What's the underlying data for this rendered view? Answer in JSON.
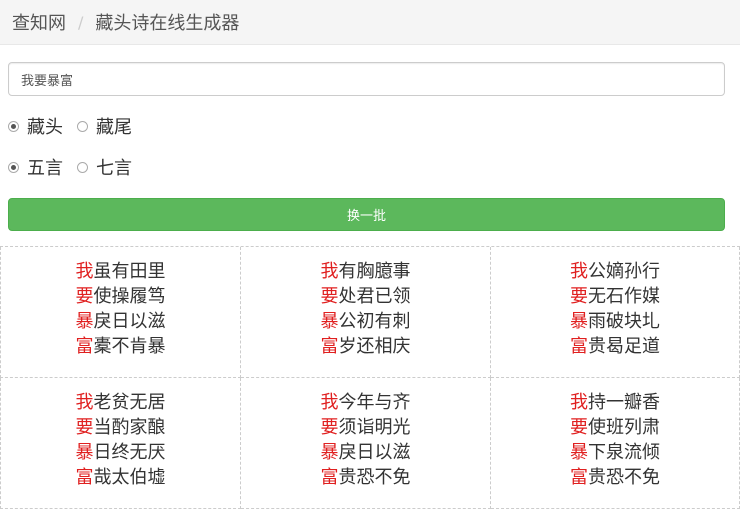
{
  "breadcrumb": {
    "site": "查知网",
    "separator": "/",
    "page": "藏头诗在线生成器"
  },
  "search": {
    "value": "我要暴富"
  },
  "options": {
    "position": [
      {
        "label": "藏头",
        "checked": true
      },
      {
        "label": "藏尾",
        "checked": false
      }
    ],
    "length": [
      {
        "label": "五言",
        "checked": true
      },
      {
        "label": "七言",
        "checked": false
      }
    ]
  },
  "action_button": {
    "label": "换一批"
  },
  "accent_color": "#e02020",
  "button_color": "#5cb85c",
  "poems": [
    {
      "lines": [
        {
          "head": "我",
          "rest": "虽有田里"
        },
        {
          "head": "要",
          "rest": "使操履笃"
        },
        {
          "head": "暴",
          "rest": "戾日以滋"
        },
        {
          "head": "富",
          "rest": "橐不肯暴"
        }
      ]
    },
    {
      "lines": [
        {
          "head": "我",
          "rest": "有胸臆事"
        },
        {
          "head": "要",
          "rest": "处君已领"
        },
        {
          "head": "暴",
          "rest": "公初有刺"
        },
        {
          "head": "富",
          "rest": "岁还相庆"
        }
      ]
    },
    {
      "lines": [
        {
          "head": "我",
          "rest": "公嫡孙行"
        },
        {
          "head": "要",
          "rest": "无石作媒"
        },
        {
          "head": "暴",
          "rest": "雨破块圠"
        },
        {
          "head": "富",
          "rest": "贵曷足道"
        }
      ]
    },
    {
      "lines": [
        {
          "head": "我",
          "rest": "老贫无居"
        },
        {
          "head": "要",
          "rest": "当酌家酿"
        },
        {
          "head": "暴",
          "rest": "日终无厌"
        },
        {
          "head": "富",
          "rest": "哉太伯墟"
        }
      ]
    },
    {
      "lines": [
        {
          "head": "我",
          "rest": "今年与齐"
        },
        {
          "head": "要",
          "rest": "须诣明光"
        },
        {
          "head": "暴",
          "rest": "戾日以滋"
        },
        {
          "head": "富",
          "rest": "贵恐不免"
        }
      ]
    },
    {
      "lines": [
        {
          "head": "我",
          "rest": "持一瓣香"
        },
        {
          "head": "要",
          "rest": "使班列肃"
        },
        {
          "head": "暴",
          "rest": "下泉流倾"
        },
        {
          "head": "富",
          "rest": "贵恐不免"
        }
      ]
    }
  ]
}
